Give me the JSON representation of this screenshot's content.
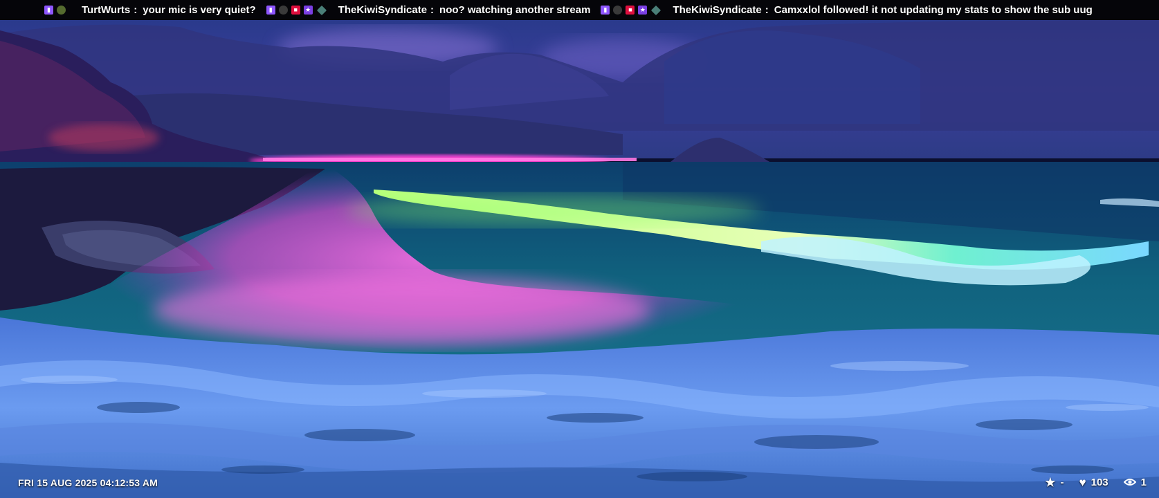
{
  "chat": {
    "messages": [
      {
        "user": "TurtWurts",
        "text": "your mic is very quiet?",
        "badges": [
          "twitch-icon",
          "globe-icon"
        ]
      },
      {
        "user": "TheKiwiSyndicate",
        "text": "noo?  watching another stream",
        "badges": [
          "twitch-icon",
          "mouse-icon",
          "camera-icon",
          "star-icon",
          "gem-icon"
        ]
      },
      {
        "user": "TheKiwiSyndicate",
        "text": "Camxxlol followed!  it not updating my stats to show the sub uug",
        "badges": [
          "twitch-icon",
          "mouse-icon",
          "camera-icon",
          "star-icon",
          "gem-icon"
        ]
      }
    ],
    "separator": ":"
  },
  "overlay": {
    "datetime": "FRI 15 AUG 2025 04:12:53 AM",
    "rating_icon": "star-icon",
    "rating": "-",
    "likes_icon": "heart-icon",
    "likes": "103",
    "viewers_icon": "eye-icon",
    "viewers": "1"
  },
  "colors": {
    "ticker_bg": "#050509",
    "twitch_badge": "#8f57ff",
    "cam_badge": "#e0103f",
    "glow_pink": "#ff4fd8",
    "wave_green": "#9dff6a"
  }
}
